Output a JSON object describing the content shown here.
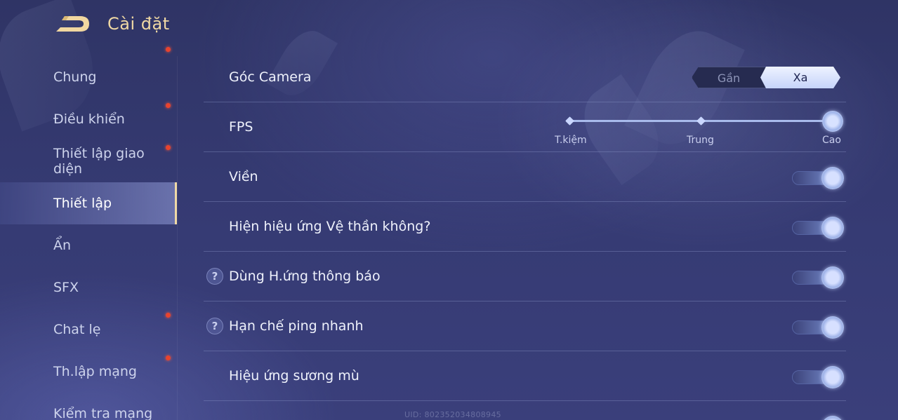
{
  "header": {
    "title": "Cài đặt"
  },
  "sidebar": {
    "items": [
      {
        "label": "Chung",
        "dot": false,
        "active": false
      },
      {
        "label": "Điều khiển",
        "dot": true,
        "active": false
      },
      {
        "label": "Thiết lập giao diện",
        "dot": true,
        "active": false
      },
      {
        "label": "Thiết lập",
        "dot": false,
        "active": true
      },
      {
        "label": "Ẩn",
        "dot": false,
        "active": false
      },
      {
        "label": "SFX",
        "dot": false,
        "active": false
      },
      {
        "label": "Chat lẹ",
        "dot": true,
        "active": false
      },
      {
        "label": "Th.lập mạng",
        "dot": true,
        "active": false
      },
      {
        "label": "Kiểm tra mạng",
        "dot": false,
        "active": false
      }
    ]
  },
  "settings": {
    "camera": {
      "label": "Góc Camera",
      "options": [
        "Gần",
        "Xa"
      ],
      "selected": "Xa"
    },
    "fps": {
      "label": "FPS",
      "ticks": [
        "T.kiệm",
        "Trung",
        "Cao"
      ],
      "selected_index": 2
    },
    "toggles": [
      {
        "label": "Viền",
        "on": true,
        "help": false
      },
      {
        "label": "Hiện hiệu ứng Vệ thần không?",
        "on": true,
        "help": false
      },
      {
        "label": "Dùng H.ứng thông báo",
        "on": true,
        "help": true
      },
      {
        "label": "Hạn chế ping nhanh",
        "on": true,
        "help": true
      },
      {
        "label": "Hiệu ứng sương mù",
        "on": true,
        "help": false
      }
    ]
  },
  "footer": {
    "uid": "UID: 802352034808945"
  },
  "colors": {
    "accent_gold": "#efd8a4",
    "notification_dot": "#e8432e",
    "toggle_on": "#7f96d8"
  }
}
